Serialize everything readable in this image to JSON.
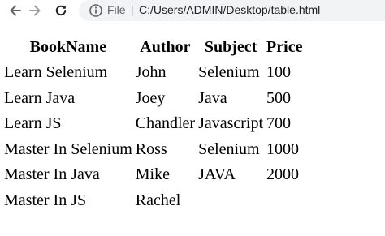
{
  "browser": {
    "back_icon": "arrow-left-icon",
    "forward_icon": "arrow-right-icon",
    "reload_icon": "reload-icon",
    "info_icon": "info-icon",
    "scheme_label": "File",
    "separator": "|",
    "url": "C:/Users/ADMIN/Desktop/table.html"
  },
  "table": {
    "headers": [
      "BookName",
      "Author",
      "Subject",
      "Price"
    ],
    "rows": [
      [
        "Learn Selenium",
        "John",
        "Selenium",
        "100"
      ],
      [
        "Learn Java",
        "Joey",
        "Java",
        "500"
      ],
      [
        "Learn JS",
        "Chandler",
        "Javascript",
        "700"
      ],
      [
        "Master In Selenium",
        "Ross",
        "Selenium",
        "1000"
      ],
      [
        "Master In Java",
        "Mike",
        "JAVA",
        "2000"
      ],
      [
        "Master In JS",
        "Rachel",
        "",
        ""
      ]
    ]
  }
}
